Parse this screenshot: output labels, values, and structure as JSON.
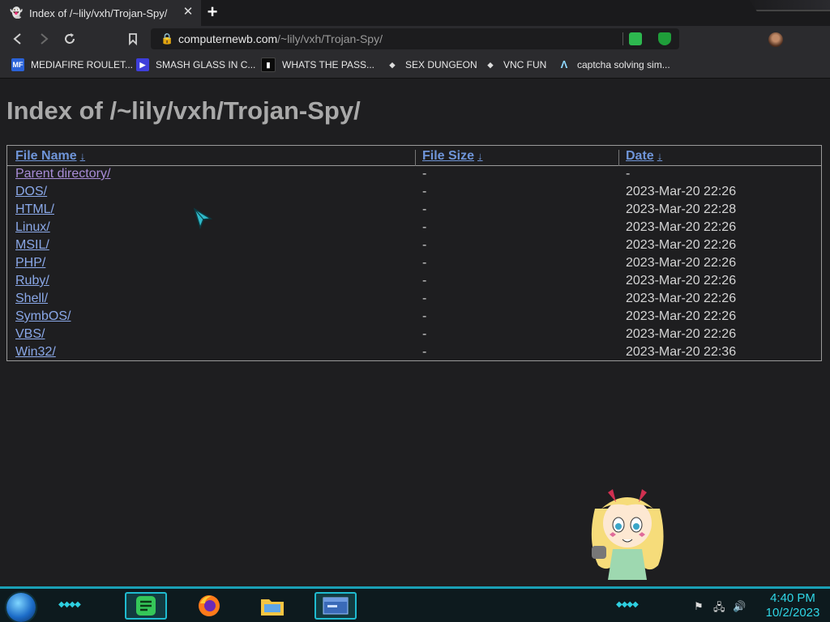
{
  "browser": {
    "tab": {
      "title": "Index of /~lily/vxh/Trojan-Spy/",
      "close_glyph": "✕",
      "favicon": "ghost-icon"
    },
    "new_tab_glyph": "+",
    "toolbar": {
      "back_icon": "back-icon",
      "forward_icon": "forward-icon",
      "reload_icon": "reload-icon",
      "bookmark_icon": "bookmark-icon",
      "url_host": "computernewb.com",
      "url_path": "/~lily/vxh/Trojan-Spy/",
      "menu_icon": "hamburger-menu-icon"
    },
    "bookmarks": [
      {
        "label": "MEDIAFIRE ROULET...",
        "icon": "MF",
        "color": "#2a62d8"
      },
      {
        "label": "SMASH GLASS IN C...",
        "icon": "▶",
        "color": "#3e3edb"
      },
      {
        "label": "WHATS THE PASS...",
        "icon": "▮",
        "color": "#111111"
      },
      {
        "label": "SEX DUNGEON",
        "icon": "◆",
        "color": "#2b2b2e"
      },
      {
        "label": "VNC FUN",
        "icon": "◆",
        "color": "#2b2b2e"
      },
      {
        "label": "captcha solving sim...",
        "icon": "Λ",
        "color": "#2b2b2e"
      }
    ]
  },
  "page": {
    "title": "Index of /~lily/vxh/Trojan-Spy/",
    "headers": {
      "name": "File Name",
      "size": "File Size",
      "date": "Date",
      "sort_arrow": "↓"
    },
    "rows": [
      {
        "name": "Parent directory/",
        "size": "-",
        "date": "-"
      },
      {
        "name": "DOS/",
        "size": "-",
        "date": "2023-Mar-20 22:26"
      },
      {
        "name": "HTML/",
        "size": "-",
        "date": "2023-Mar-20 22:28"
      },
      {
        "name": "Linux/",
        "size": "-",
        "date": "2023-Mar-20 22:26"
      },
      {
        "name": "MSIL/",
        "size": "-",
        "date": "2023-Mar-20 22:26"
      },
      {
        "name": "PHP/",
        "size": "-",
        "date": "2023-Mar-20 22:26"
      },
      {
        "name": "Ruby/",
        "size": "-",
        "date": "2023-Mar-20 22:26"
      },
      {
        "name": "Shell/",
        "size": "-",
        "date": "2023-Mar-20 22:26"
      },
      {
        "name": "SymbOS/",
        "size": "-",
        "date": "2023-Mar-20 22:26"
      },
      {
        "name": "VBS/",
        "size": "-",
        "date": "2023-Mar-20 22:26"
      },
      {
        "name": "Win32/",
        "size": "-",
        "date": "2023-Mar-20 22:36"
      }
    ]
  },
  "taskbar": {
    "apps": [
      "notes-icon",
      "firefox-icon",
      "file-explorer-icon",
      "window-icon"
    ],
    "tray": [
      "flag-icon",
      "network-icon",
      "volume-icon"
    ],
    "time": "4:40 PM",
    "date": "10/2/2023"
  },
  "colors": {
    "accent": "#1aa0b5",
    "link": "#8aa8e8",
    "visited": "#a98dd8",
    "heading": "#a9a9a9"
  }
}
